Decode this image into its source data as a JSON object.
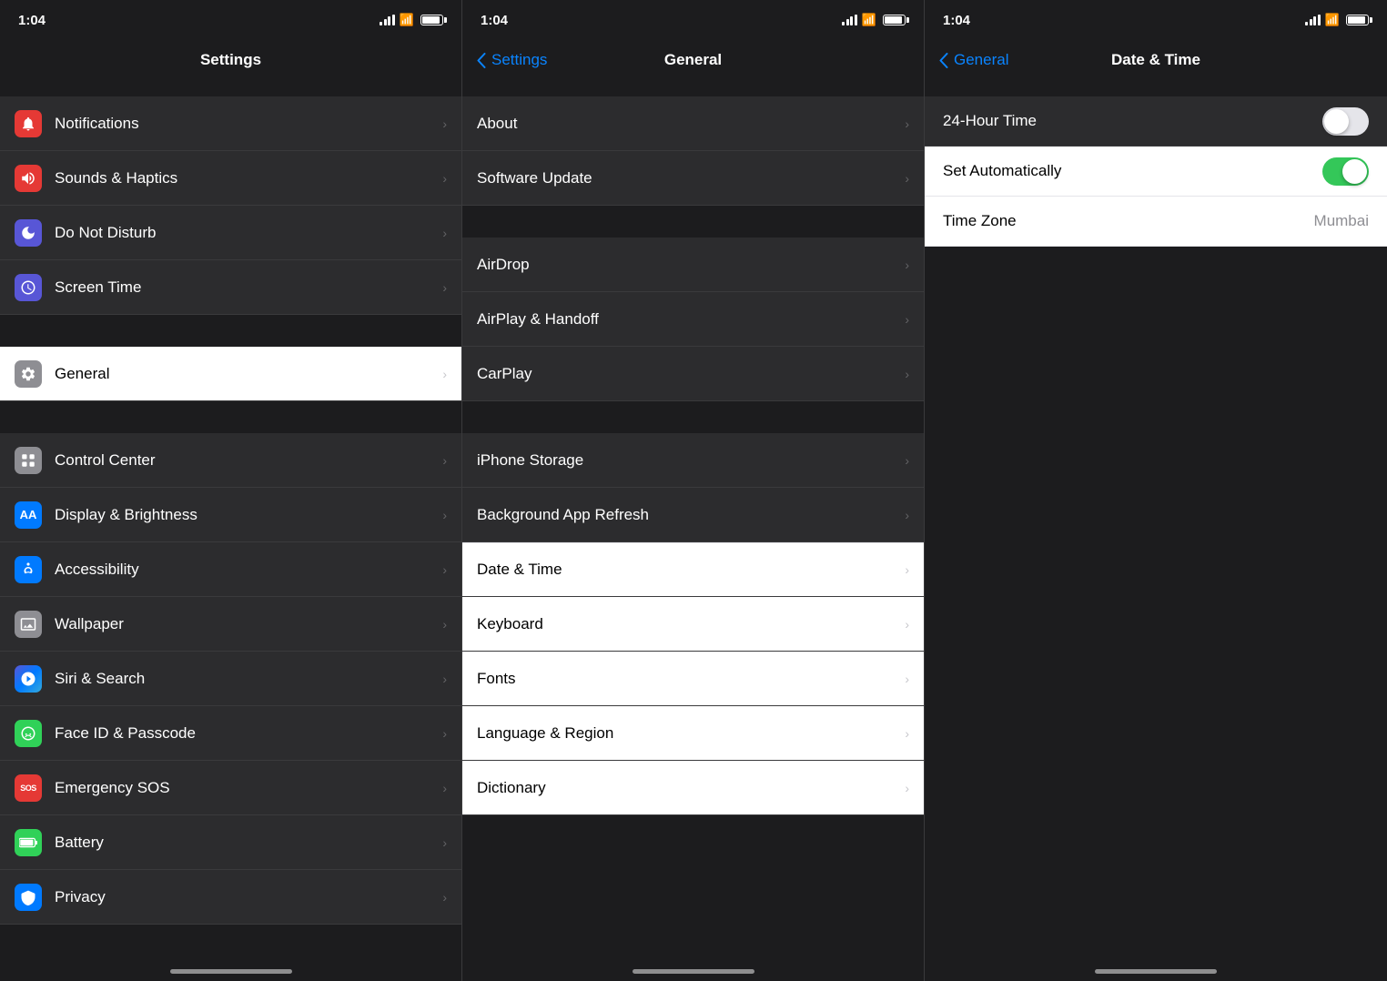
{
  "panels": {
    "panel1": {
      "statusTime": "1:04",
      "navTitle": "Settings",
      "sections": [
        {
          "items": [
            {
              "id": "notifications",
              "label": "Notifications",
              "iconBg": "#e53935",
              "iconSymbol": "🔔"
            },
            {
              "id": "sounds",
              "label": "Sounds & Haptics",
              "iconBg": "#e53935",
              "iconSymbol": "🔊"
            },
            {
              "id": "donotdisturb",
              "label": "Do Not Disturb",
              "iconBg": "#5856d6",
              "iconSymbol": "🌙"
            },
            {
              "id": "screentime",
              "label": "Screen Time",
              "iconBg": "#5856d6",
              "iconSymbol": "⏱"
            }
          ]
        },
        {
          "items": [
            {
              "id": "general",
              "label": "General",
              "iconBg": "#8e8e93",
              "iconSymbol": "⚙️",
              "active": true
            }
          ]
        },
        {
          "items": [
            {
              "id": "controlcenter",
              "label": "Control Center",
              "iconBg": "#8e8e93",
              "iconSymbol": "⊞"
            },
            {
              "id": "display",
              "label": "Display & Brightness",
              "iconBg": "#007aff",
              "iconSymbol": "AA"
            },
            {
              "id": "accessibility",
              "label": "Accessibility",
              "iconBg": "#007aff",
              "iconSymbol": "♿"
            },
            {
              "id": "wallpaper",
              "label": "Wallpaper",
              "iconBg": "#8e8e93",
              "iconSymbol": "❋"
            },
            {
              "id": "siri",
              "label": "Siri & Search",
              "iconBg": "#000",
              "iconSymbol": "⟡"
            },
            {
              "id": "faceid",
              "label": "Face ID & Passcode",
              "iconBg": "#30d158",
              "iconSymbol": "👤"
            },
            {
              "id": "emergencysos",
              "label": "Emergency SOS",
              "iconBg": "#e53935",
              "iconSymbol": "SOS"
            },
            {
              "id": "battery",
              "label": "Battery",
              "iconBg": "#30d158",
              "iconSymbol": "▬"
            },
            {
              "id": "privacy",
              "label": "Privacy",
              "iconBg": "#007aff",
              "iconSymbol": "✋"
            }
          ]
        }
      ]
    },
    "panel2": {
      "statusTime": "1:04",
      "navTitle": "General",
      "navBack": "Settings",
      "sections": [
        {
          "items": [
            {
              "id": "about",
              "label": "About"
            },
            {
              "id": "softwareupdate",
              "label": "Software Update"
            }
          ]
        },
        {
          "items": [
            {
              "id": "airdrop",
              "label": "AirDrop"
            },
            {
              "id": "airplay",
              "label": "AirPlay & Handoff"
            },
            {
              "id": "carplay",
              "label": "CarPlay"
            }
          ]
        },
        {
          "items": [
            {
              "id": "iphonestorage",
              "label": "iPhone Storage"
            },
            {
              "id": "backgroundapp",
              "label": "Background App Refresh"
            }
          ]
        },
        {
          "items": [
            {
              "id": "datetime",
              "label": "Date & Time",
              "highlighted": true
            },
            {
              "id": "keyboard",
              "label": "Keyboard"
            },
            {
              "id": "fonts",
              "label": "Fonts"
            },
            {
              "id": "language",
              "label": "Language & Region"
            },
            {
              "id": "dictionary",
              "label": "Dictionary"
            }
          ]
        }
      ]
    },
    "panel3": {
      "statusTime": "1:04",
      "navTitle": "Date & Time",
      "navBack": "General",
      "items": [
        {
          "id": "24hourtime",
          "label": "24-Hour Time",
          "type": "toggle",
          "value": false,
          "section": "gray"
        },
        {
          "id": "setautomatically",
          "label": "Set Automatically",
          "type": "toggle",
          "value": true,
          "section": "white"
        },
        {
          "id": "timezone",
          "label": "Time Zone",
          "type": "value",
          "value": "Mumbai",
          "section": "white"
        }
      ]
    }
  },
  "icons": {
    "chevron": "›",
    "backChevron": "‹"
  }
}
